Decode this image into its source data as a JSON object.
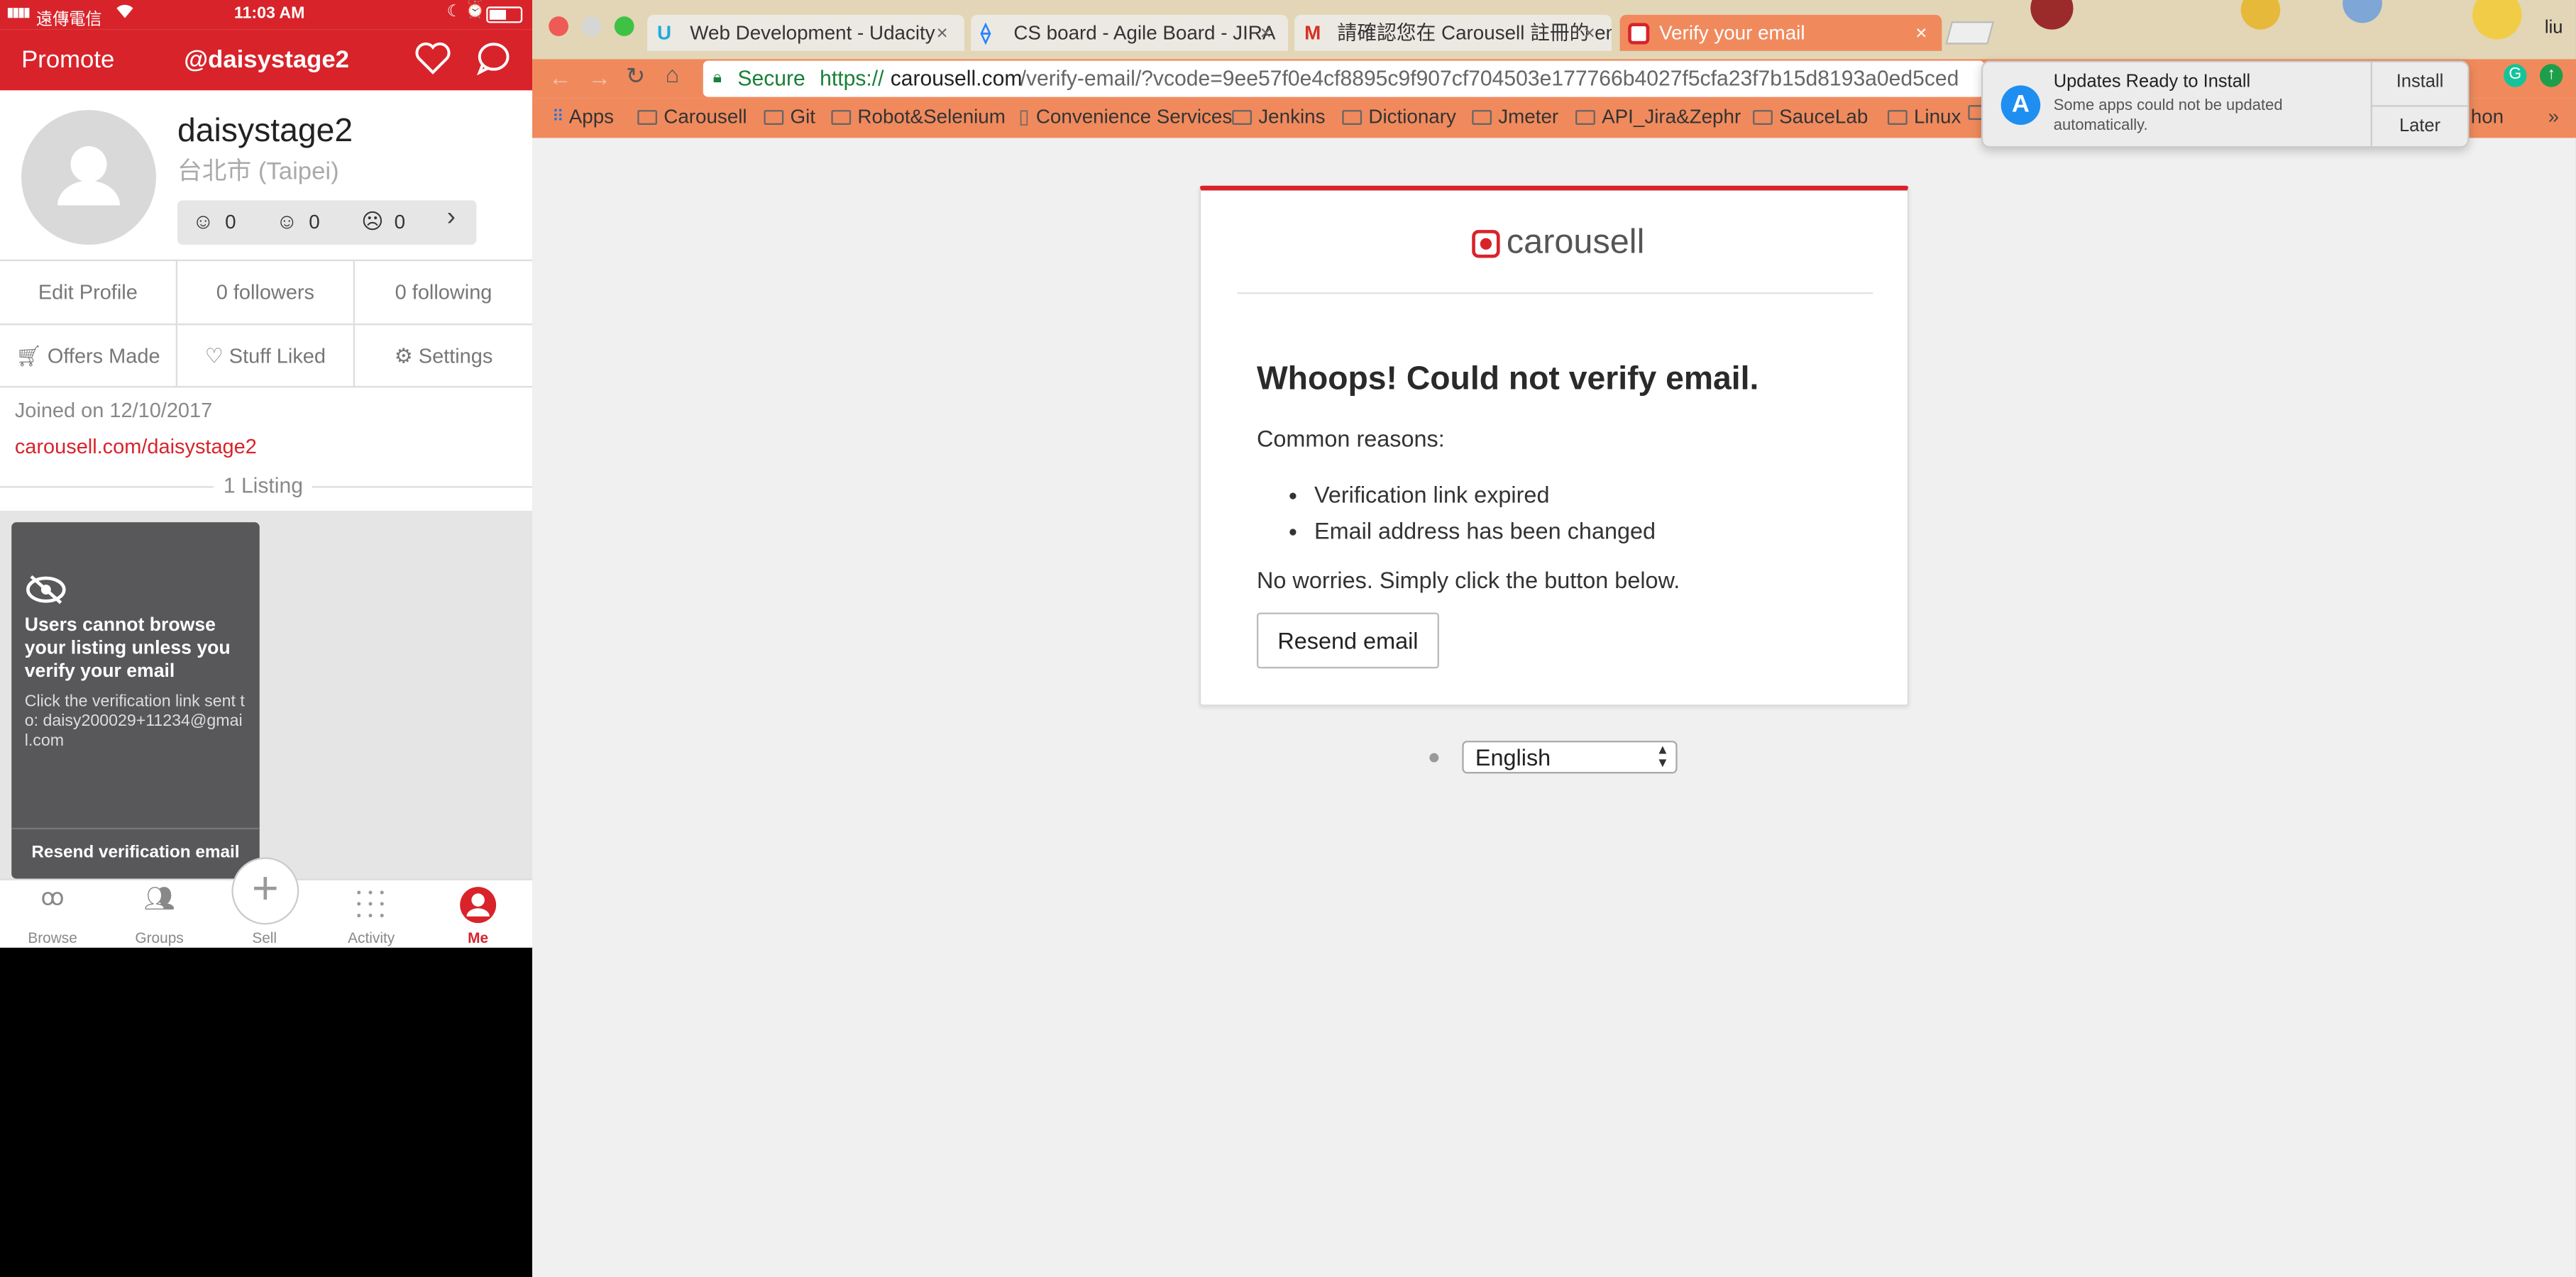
{
  "phone": {
    "status": {
      "carrier": "遠傳電信",
      "time": "11:03 AM"
    },
    "nav": {
      "promote": "Promote",
      "username": "@daisystage2"
    },
    "profile": {
      "name": "daisystage2",
      "location": "台北市 (Taipei)",
      "ratings": {
        "positive": "0",
        "neutral": "0",
        "negative": "0"
      }
    },
    "stats": {
      "edit_profile": "Edit Profile",
      "followers": "0 followers",
      "following": "0 following"
    },
    "actions": {
      "offers": "Offers Made",
      "liked": "Stuff Liked",
      "settings": "Settings"
    },
    "joined": "Joined on 12/10/2017",
    "profile_link": "carousell.com/daisystage2",
    "listing_count": "1 Listing",
    "listing_card": {
      "title": "Users cannot browse your listing unless you verify your email",
      "body": "Click the verification link sent to: daisy200029+11234@gmail.com",
      "button": "Resend verification email"
    },
    "tabbar": {
      "browse": "Browse",
      "groups": "Groups",
      "sell": "Sell",
      "activity": "Activity",
      "me": "Me"
    },
    "colors": {
      "brand": "#d8232a"
    }
  },
  "browser": {
    "tabs": [
      {
        "title": "Web Development - Udacity"
      },
      {
        "title": "CS board - Agile Board - JIRA"
      },
      {
        "title": "請確認您在 Carousell 註冊的 em"
      },
      {
        "title": "Verify your email"
      }
    ],
    "address": {
      "secure": "Secure",
      "url_scheme": "https://",
      "url_host": "carousell.com",
      "url_path": "/verify-email/?vcode=9ee57f0e4cf8895c9f907cf704503e177766b4027f5cfa23f7b15d8193a0ed5ced"
    },
    "bookmarks": [
      "Apps",
      "Carousell",
      "Git",
      "Robot&Selenium",
      "Convenience Services",
      "Jenkins",
      "Dictionary",
      "Jmeter",
      "API_Jira&Zephr",
      "SauceLab",
      "Linux"
    ],
    "bookmark_tail": "hon",
    "user_label": "liu",
    "notification": {
      "title": "Updates Ready to Install",
      "body": "Some apps could not be updated automatically.",
      "install": "Install",
      "later": "Later"
    },
    "page": {
      "logo_text": "carousell",
      "heading": "Whoops! Could not verify email.",
      "reasons_label": "Common reasons:",
      "reasons": [
        "Verification link expired",
        "Email address has been changed"
      ],
      "note": "No worries. Simply click the button below.",
      "resend_button": "Resend email",
      "language": "English"
    }
  }
}
